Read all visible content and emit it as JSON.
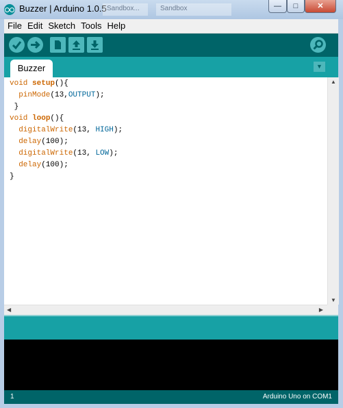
{
  "window": {
    "title": "Buzzer | Arduino 1.0.5",
    "background_tabs": [
      "Sandbox...",
      "Sandbox"
    ],
    "controls": {
      "minimize": "—",
      "maximize": "□",
      "close": "✕"
    }
  },
  "menu": [
    "File",
    "Edit",
    "Sketch",
    "Tools",
    "Help"
  ],
  "toolbar": {
    "verify_icon": "check-icon",
    "upload_icon": "arrow-right-icon",
    "new_icon": "new-document-icon",
    "open_icon": "upload-arrow-icon",
    "save_icon": "download-arrow-icon",
    "serial_monitor_icon": "magnifier-icon"
  },
  "tab": {
    "label": "Buzzer"
  },
  "code": [
    [
      {
        "t": "void ",
        "c": "type"
      },
      {
        "t": "setup",
        "c": "fn"
      },
      {
        "t": "(){",
        "c": ""
      }
    ],
    [
      {
        "t": "  ",
        "c": ""
      },
      {
        "t": "pinMode",
        "c": "call"
      },
      {
        "t": "(13,",
        "c": ""
      },
      {
        "t": "OUTPUT",
        "c": "const"
      },
      {
        "t": ");",
        "c": ""
      }
    ],
    [
      {
        "t": " }",
        "c": ""
      }
    ],
    [
      {
        "t": "void ",
        "c": "type"
      },
      {
        "t": "loop",
        "c": "fn"
      },
      {
        "t": "(){",
        "c": ""
      }
    ],
    [
      {
        "t": "  ",
        "c": ""
      },
      {
        "t": "digitalWrite",
        "c": "call"
      },
      {
        "t": "(13, ",
        "c": ""
      },
      {
        "t": "HIGH",
        "c": "const"
      },
      {
        "t": ");",
        "c": ""
      }
    ],
    [
      {
        "t": "  ",
        "c": ""
      },
      {
        "t": "delay",
        "c": "call"
      },
      {
        "t": "(100);",
        "c": ""
      }
    ],
    [
      {
        "t": "  ",
        "c": ""
      },
      {
        "t": "digitalWrite",
        "c": "call"
      },
      {
        "t": "(13, ",
        "c": ""
      },
      {
        "t": "LOW",
        "c": "const"
      },
      {
        "t": ");",
        "c": ""
      }
    ],
    [
      {
        "t": "  ",
        "c": ""
      },
      {
        "t": "delay",
        "c": "call"
      },
      {
        "t": "(100);",
        "c": ""
      }
    ],
    [
      {
        "t": "}",
        "c": ""
      }
    ]
  ],
  "footer": {
    "line": "1",
    "board": "Arduino Uno on COM1"
  },
  "colors": {
    "toolbar": "#006468",
    "tabstrip": "#17a1a5",
    "console": "#000000",
    "keyword": "#cc6600",
    "constant": "#006699"
  }
}
